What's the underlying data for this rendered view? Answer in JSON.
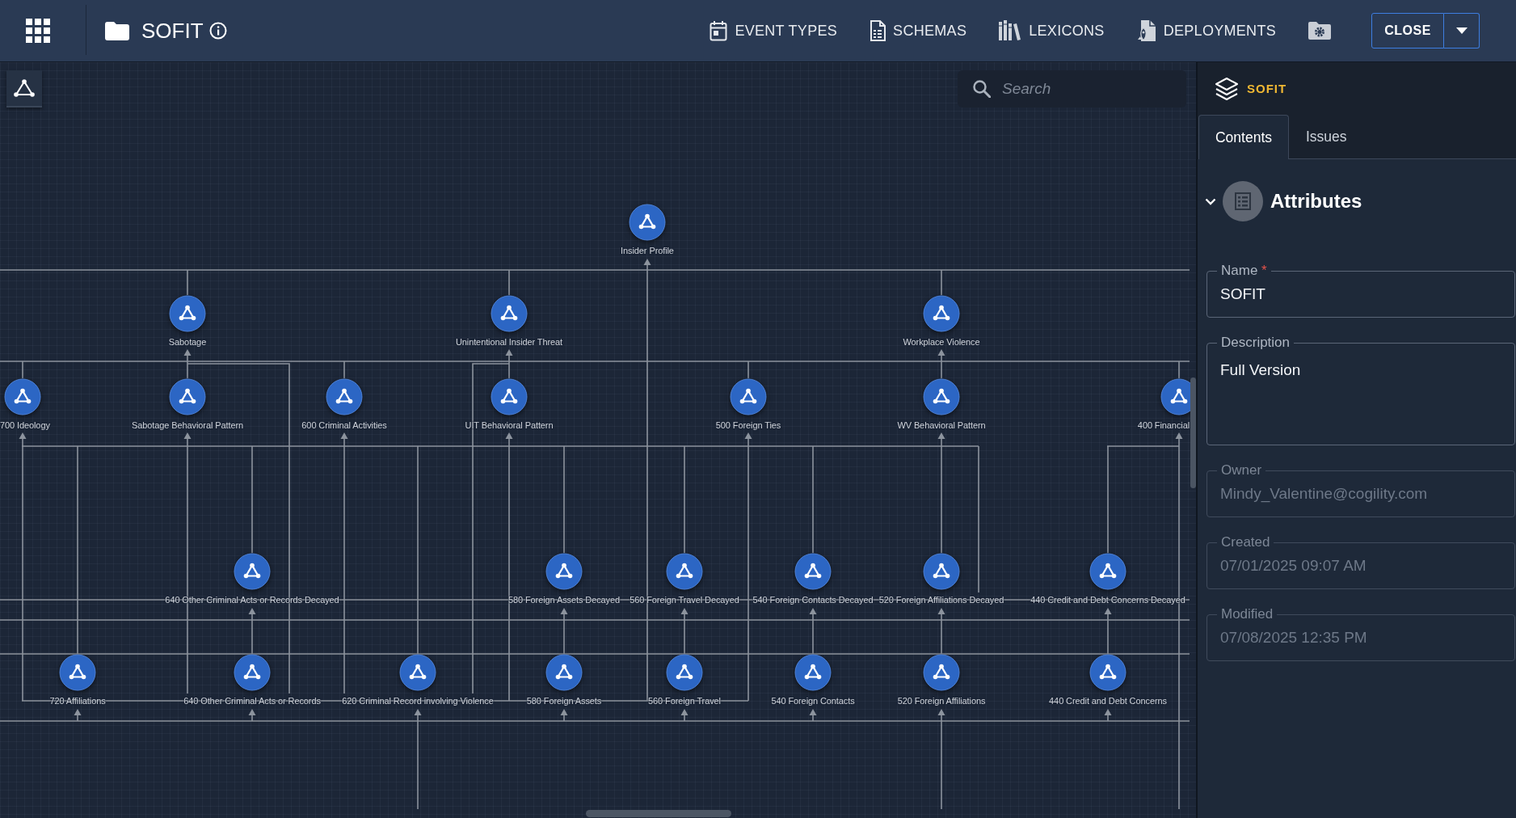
{
  "top_bar": {
    "title": "SOFIT",
    "nav": [
      {
        "label": "EVENT TYPES"
      },
      {
        "label": "SCHEMAS"
      },
      {
        "label": "LEXICONS"
      },
      {
        "label": "DEPLOYMENTS"
      }
    ],
    "close_button": {
      "label": "CLOSE"
    }
  },
  "canvas": {
    "search": {
      "placeholder": "Search"
    },
    "nodes": [
      {
        "label": "Insider Profile"
      },
      {
        "label": "Sabotage"
      },
      {
        "label": "Unintentional Insider Threat"
      },
      {
        "label": "Workplace Violence"
      },
      {
        "label": "700 Ideology"
      },
      {
        "label": "Sabotage Behavioral Pattern"
      },
      {
        "label": "600 Criminal Activities"
      },
      {
        "label": "UIT Behavioral Pattern"
      },
      {
        "label": "500 Foreign Ties"
      },
      {
        "label": "WV Behavioral Pattern"
      },
      {
        "label": "400 Financial"
      },
      {
        "label": "640 Other Criminal Acts or Records Decayed"
      },
      {
        "label": "580 Foreign Assets Decayed"
      },
      {
        "label": "560 Foreign Travel Decayed"
      },
      {
        "label": "540 Foreign Contacts Decayed"
      },
      {
        "label": "520 Foreign Affiliations Decayed"
      },
      {
        "label": "440 Credit and Debt Concerns Decayed"
      },
      {
        "label": "720 Affiliations"
      },
      {
        "label": "640 Other Criminal Acts or Records"
      },
      {
        "label": "620 Criminal Record involving Violence"
      },
      {
        "label": "580 Foreign Assets"
      },
      {
        "label": "560 Foreign Travel"
      },
      {
        "label": "540 Foreign Contacts"
      },
      {
        "label": "520 Foreign Affiliations"
      },
      {
        "label": "440 Credit and Debt Concerns"
      }
    ]
  },
  "panel": {
    "title": "SOFIT",
    "tabs": [
      {
        "label": "Contents",
        "selected": true
      },
      {
        "label": "Issues",
        "selected": false
      }
    ],
    "section": {
      "title": "Attributes",
      "expanded": true
    },
    "fields": [
      {
        "label": "Name",
        "required_mark": "*",
        "value": "SOFIT",
        "kind": "text",
        "disabled": false
      },
      {
        "label": "Description",
        "value": "Full Version",
        "kind": "textarea",
        "disabled": false
      },
      {
        "label": "Owner",
        "value": "Mindy_Valentine@cogility.com",
        "kind": "text",
        "disabled": true
      },
      {
        "label": "Created",
        "value": "07/01/2025 09:07 AM",
        "kind": "text",
        "disabled": true
      },
      {
        "label": "Modified",
        "value": "07/08/2025 12:35 PM",
        "kind": "text",
        "disabled": true
      }
    ]
  }
}
